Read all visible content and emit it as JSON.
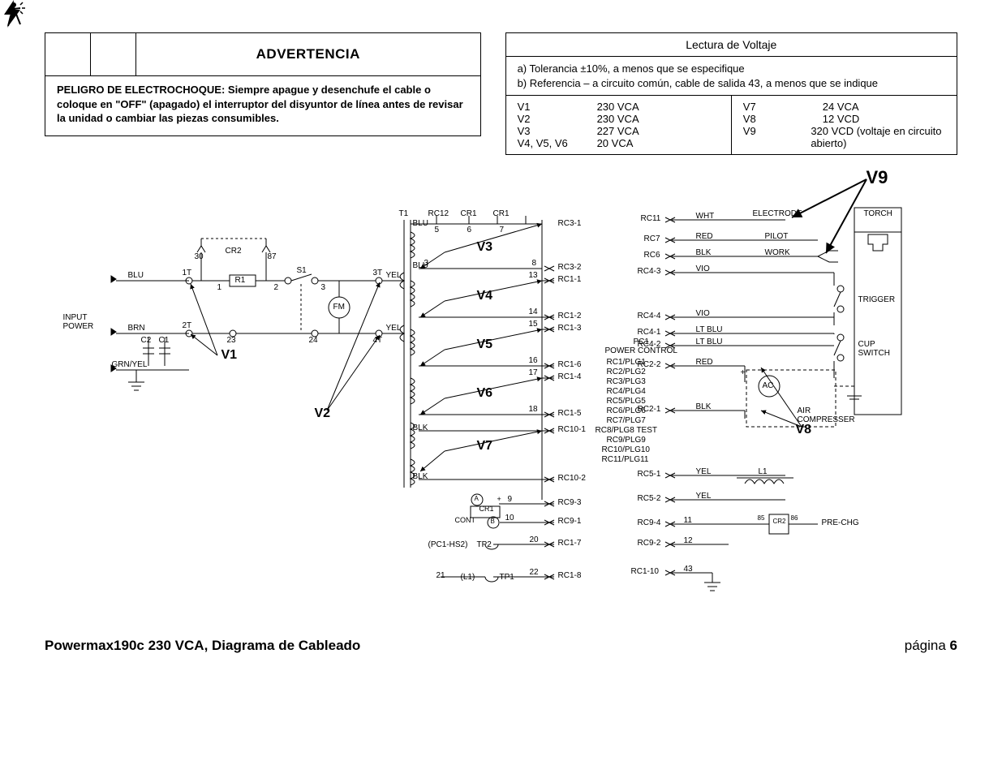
{
  "warning": {
    "title": "ADVERTENCIA",
    "body": "PELIGRO DE ELECTROCHOQUE:  Siempre apague y desenchufe el cable o coloque en \"OFF\" (apagado) el interruptor del disyuntor de línea antes de revisar la unidad o cambiar las piezas consumibles."
  },
  "voltage_table": {
    "title": "Lectura de Voltaje",
    "notes": [
      "a)  Tolerancia ±10%, a menos que se especifique",
      "b)  Referencia – a circuito común, cable de salida 43, a menos que se indique"
    ],
    "left": [
      {
        "label": "V1",
        "value": "230 VCA"
      },
      {
        "label": "V2",
        "value": "230 VCA"
      },
      {
        "label": "V3",
        "value": "227 VCA"
      },
      {
        "label": "V4, V5, V6",
        "value": "20 VCA"
      }
    ],
    "right": [
      {
        "label": "V7",
        "value": "24 VCA"
      },
      {
        "label": "V8",
        "value": "12 VCD"
      },
      {
        "label": "V9",
        "value": "320 VCD (voltaje en circuito abierto)"
      }
    ]
  },
  "diagram": {
    "left_block": {
      "input_power": "INPUT\nPOWER",
      "wires": {
        "blu": "BLU",
        "brn": "BRN",
        "grn_yel": "GRN/YEL"
      },
      "terminals": {
        "t1": "1T",
        "t2": "2T",
        "t3": "3T",
        "t4": "4T"
      },
      "nodes": {
        "n1": "1",
        "n2": "2",
        "n3": "3",
        "n23": "23",
        "n24": "24"
      },
      "comps": {
        "cr2": "CR2",
        "cr2_30": "30",
        "cr2_87": "87",
        "r1": "R1",
        "s1": "S1",
        "fm": "FM",
        "c1": "C1",
        "c2": "C2"
      },
      "yel": "YEL",
      "vlabels": {
        "v1": "V1",
        "v2": "V2"
      }
    },
    "center_block": {
      "t1": "T1",
      "rc12": "RC12",
      "cr1a": "CR1",
      "cr1b": "CR1",
      "blu": "BLU",
      "blk": "BLK",
      "pins_top": {
        "p5": "5",
        "p6": "6",
        "p7": "7"
      },
      "coil_pins": {
        "p3": "3",
        "p8": "8",
        "p13": "13",
        "p14": "14",
        "p15": "15",
        "p16": "16",
        "p17": "17",
        "p18": "18"
      },
      "rc_conns": {
        "rc3_1": "RC3-1",
        "rc3_2": "RC3-2",
        "rc1_1": "RC1-1",
        "rc1_2": "RC1-2",
        "rc1_3": "RC1-3",
        "rc1_6": "RC1-6",
        "rc1_4": "RC1-4",
        "rc1_5": "RC1-5",
        "rc10_1": "RC10-1",
        "rc10_2": "RC10-2",
        "rc9_3": "RC9-3",
        "rc9_1": "RC9-1",
        "rc1_7": "RC1-7",
        "rc1_8": "RC1-8"
      },
      "extra_pins": {
        "p9": "9",
        "p10": "10",
        "p20": "20",
        "p21": "21",
        "p22": "22"
      },
      "vlabels": {
        "v3": "V3",
        "v4": "V4",
        "v5": "V5",
        "v6": "V6",
        "v7": "V7"
      },
      "cr1_bottom": "CR1",
      "cont": "CONT",
      "a": "A",
      "b": "B",
      "plus": "+",
      "pc1_hs2": "(PC1-HS2)",
      "tp1": "TP1",
      "tp2": "TP2",
      "l1": "(L1)"
    },
    "pc1": {
      "title": "PC1\nPOWER CONTROL",
      "list": [
        "RC1/PLG1",
        "RC2/PLG2",
        "RC3/PLG3",
        "RC4/PLG4",
        "RC5/PLG5",
        "RC6/PLG6",
        "RC7/PLG7",
        "RC8/PLG8 TEST",
        "RC9/PLG9",
        "RC10/PLG10",
        "RC11/PLG11"
      ]
    },
    "right_block": {
      "conns": {
        "rc11": "RC11",
        "rc7": "RC7",
        "rc6": "RC6",
        "rc4_3": "RC4-3",
        "rc4_4": "RC4-4",
        "rc4_1": "RC4-1",
        "rc4_2": "RC4-2",
        "rc2_2": "RC2-2",
        "rc2_1": "RC2-1",
        "rc5_1": "RC5-1",
        "rc5_2": "RC5-2",
        "rc9_4": "RC9-4",
        "rc9_2": "RC9-2",
        "rc1_10": "RC1-10"
      },
      "wires": {
        "wht": "WHT",
        "red": "RED",
        "blk": "BLK",
        "vio": "VIO",
        "lt_blu": "LT BLU",
        "yel": "YEL"
      },
      "labels": {
        "electrode": "ELECTRODE",
        "pilot": "PILOT",
        "work": "WORK",
        "torch": "TORCH",
        "trigger": "TRIGGER",
        "cup_switch": "CUP\nSWITCH",
        "ac": "AC",
        "air_comp": "AIR\nCOMPRESSER",
        "l1": "L1",
        "pre_chg": "PRE-CHG",
        "cr2": "CR2",
        "cr2_85": "85",
        "cr2_86": "86",
        "n11": "11",
        "n12": "12",
        "n43": "43",
        "plus": "+"
      },
      "vlabels": {
        "v8": "V8",
        "v9": "V9"
      }
    }
  },
  "footer": {
    "title": "Powermax190c 230 VCA, Diagrama de Cableado",
    "page_label": "página",
    "page_num": "6"
  }
}
